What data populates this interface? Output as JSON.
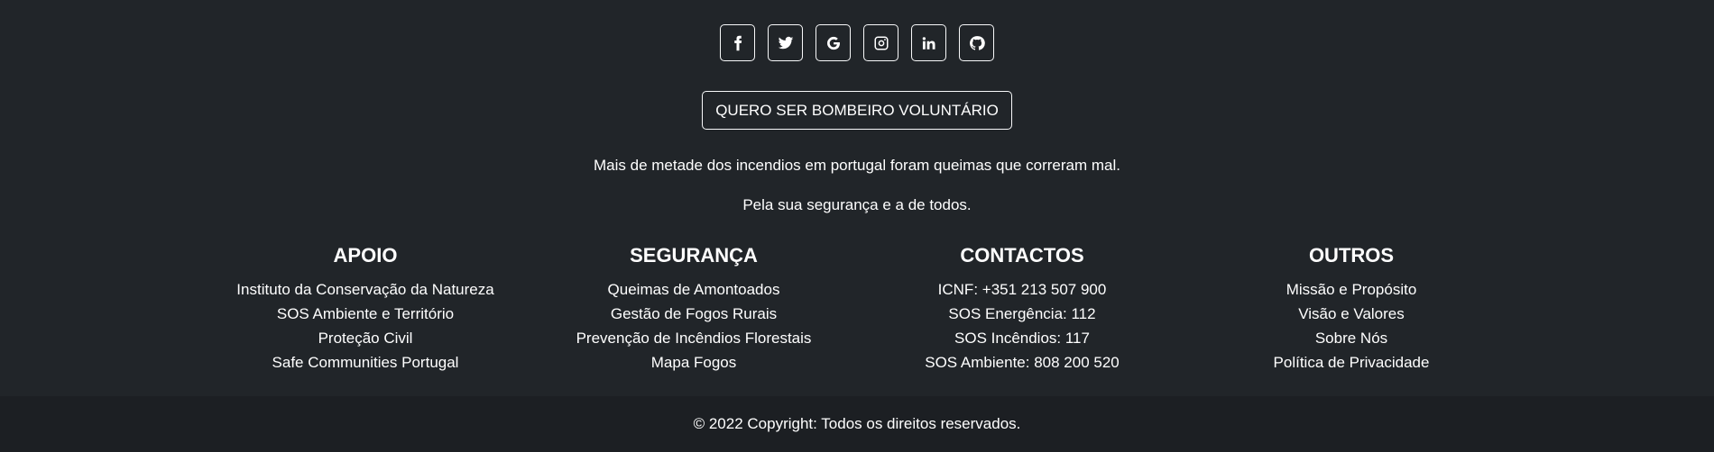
{
  "social": [
    {
      "name": "facebook-icon"
    },
    {
      "name": "twitter-icon"
    },
    {
      "name": "google-icon"
    },
    {
      "name": "instagram-icon"
    },
    {
      "name": "linkedin-icon"
    },
    {
      "name": "github-icon"
    }
  ],
  "cta": {
    "label": "QUERO SER BOMBEIRO VOLUNTÁRIO"
  },
  "messages": {
    "line1": "Mais de metade dos incendios em portugal foram queimas que correram mal.",
    "line2": "Pela sua segurança e a de todos."
  },
  "columns": [
    {
      "title": "APOIO",
      "items": [
        "Instituto da Conservação da Natureza",
        "SOS Ambiente e Território",
        "Proteção Civil",
        "Safe Communities Portugal"
      ]
    },
    {
      "title": "SEGURANÇA",
      "items": [
        "Queimas de Amontoados",
        "Gestão de Fogos Rurais",
        "Prevenção de Incêndios Florestais",
        "Mapa Fogos"
      ]
    },
    {
      "title": "CONTACTOS",
      "items": [
        "ICNF: +351 213 507 900",
        "SOS Energência: 112",
        "SOS Incêndios: 117",
        "SOS Ambiente: 808 200 520"
      ]
    },
    {
      "title": "OUTROS",
      "items": [
        "Missão e Propósito",
        "Visão e Valores",
        "Sobre Nós",
        "Política de Privacidade"
      ]
    }
  ],
  "copyright": {
    "text": "© 2022 Copyright: Todos os direitos reservados."
  },
  "colors": {
    "background": "#212529",
    "copyright_bg": "#1c1f23",
    "text": "#ffffff",
    "border": "#f8f9fa"
  }
}
